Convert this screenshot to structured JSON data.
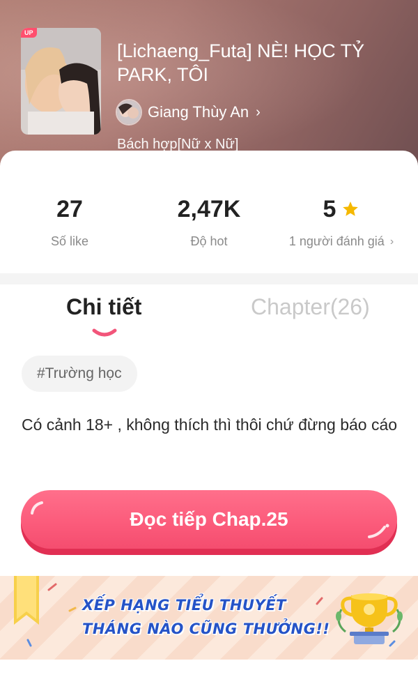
{
  "story": {
    "badge": "UP",
    "title": "[Lichaeng_Futa] NÈ! HỌC TỶ PARK, TÔI",
    "author": "Giang Thùy An",
    "genre": "Bách hợp[Nữ x Nữ]"
  },
  "stats": {
    "likes": {
      "value": "27",
      "label": "Số like"
    },
    "hot": {
      "value": "2,47K",
      "label": "Độ hot"
    },
    "rating": {
      "value": "5",
      "label": "1 người đánh giá"
    }
  },
  "tabs": {
    "details": "Chi tiết",
    "chapters": "Chapter(26)"
  },
  "tag": "#Trường học",
  "description": "Có cảnh 18+ , không thích thì thôi chứ đừng báo cáo",
  "read_button": "Đọc tiếp Chap.25",
  "banner": {
    "line1": "XẾP HẠNG TIỂU THUYẾT",
    "line2": "THÁNG NÀO CŨNG THƯỞNG!!"
  },
  "colors": {
    "accent": "#fb5a7a",
    "banner_text": "#2553c7",
    "star": "#f5b800"
  },
  "icons": {
    "star": "star-icon",
    "chevron": "chevron-right-icon",
    "trophy": "trophy-icon",
    "ribbon": "bookmark-ribbon-icon"
  }
}
